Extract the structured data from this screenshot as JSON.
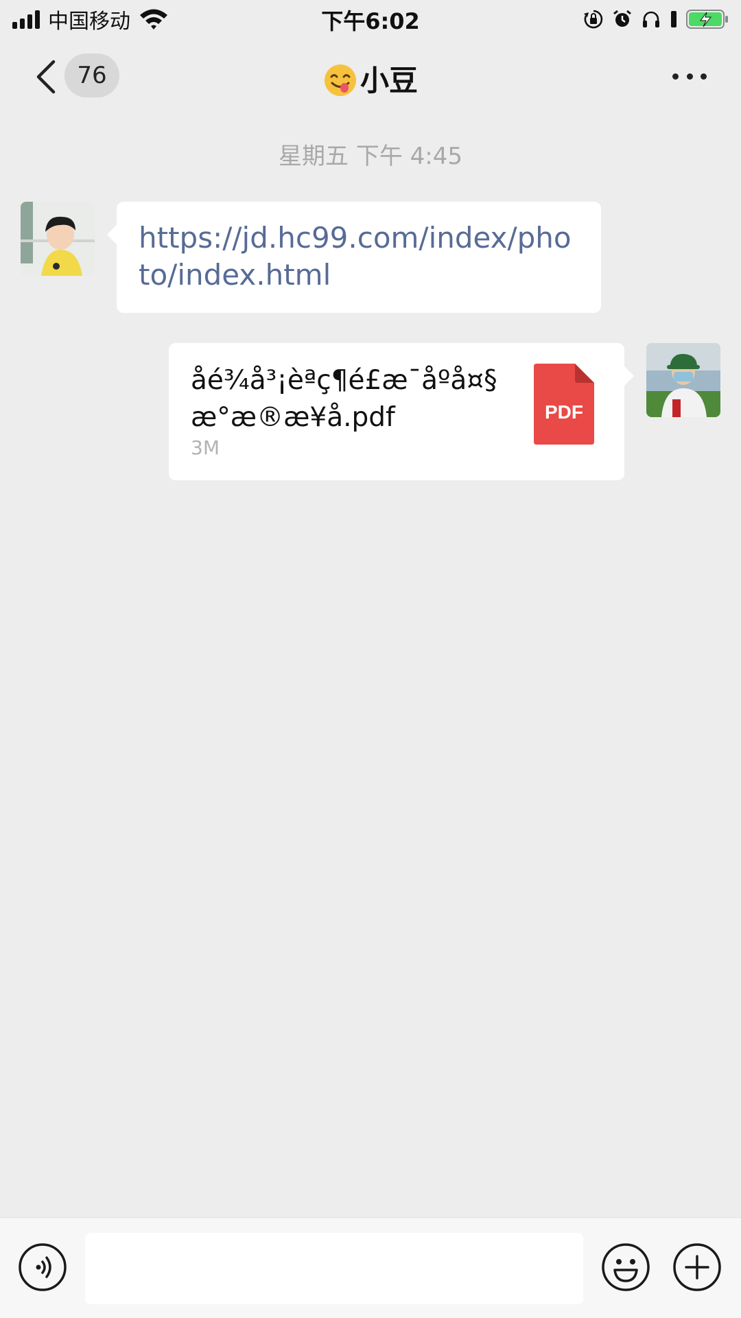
{
  "status_bar": {
    "carrier": "中国移动",
    "time": "下午6:02",
    "icons": [
      "signal-icon",
      "wifi-icon",
      "orientation-lock-icon",
      "alarm-icon",
      "headphones-icon",
      "battery-charging-icon"
    ]
  },
  "nav": {
    "unread_count": "76",
    "title_emoji": "savoring-face-emoji",
    "title": "小豆"
  },
  "messages": {
    "timestamp": "星期五 下午 4:45",
    "incoming_link": "https://jd.hc99.com/index/photo/index.html",
    "outgoing_file": {
      "name": "åé¾å³¡èªç¶é£æ¯åºå¤§æ°æ®æ¥å.pdf",
      "size": "3M",
      "icon_label": "PDF"
    }
  },
  "colors": {
    "background": "#ededed",
    "link": "#576b95",
    "pdf_red": "#e94a47",
    "battery_green": "#4cd964"
  }
}
